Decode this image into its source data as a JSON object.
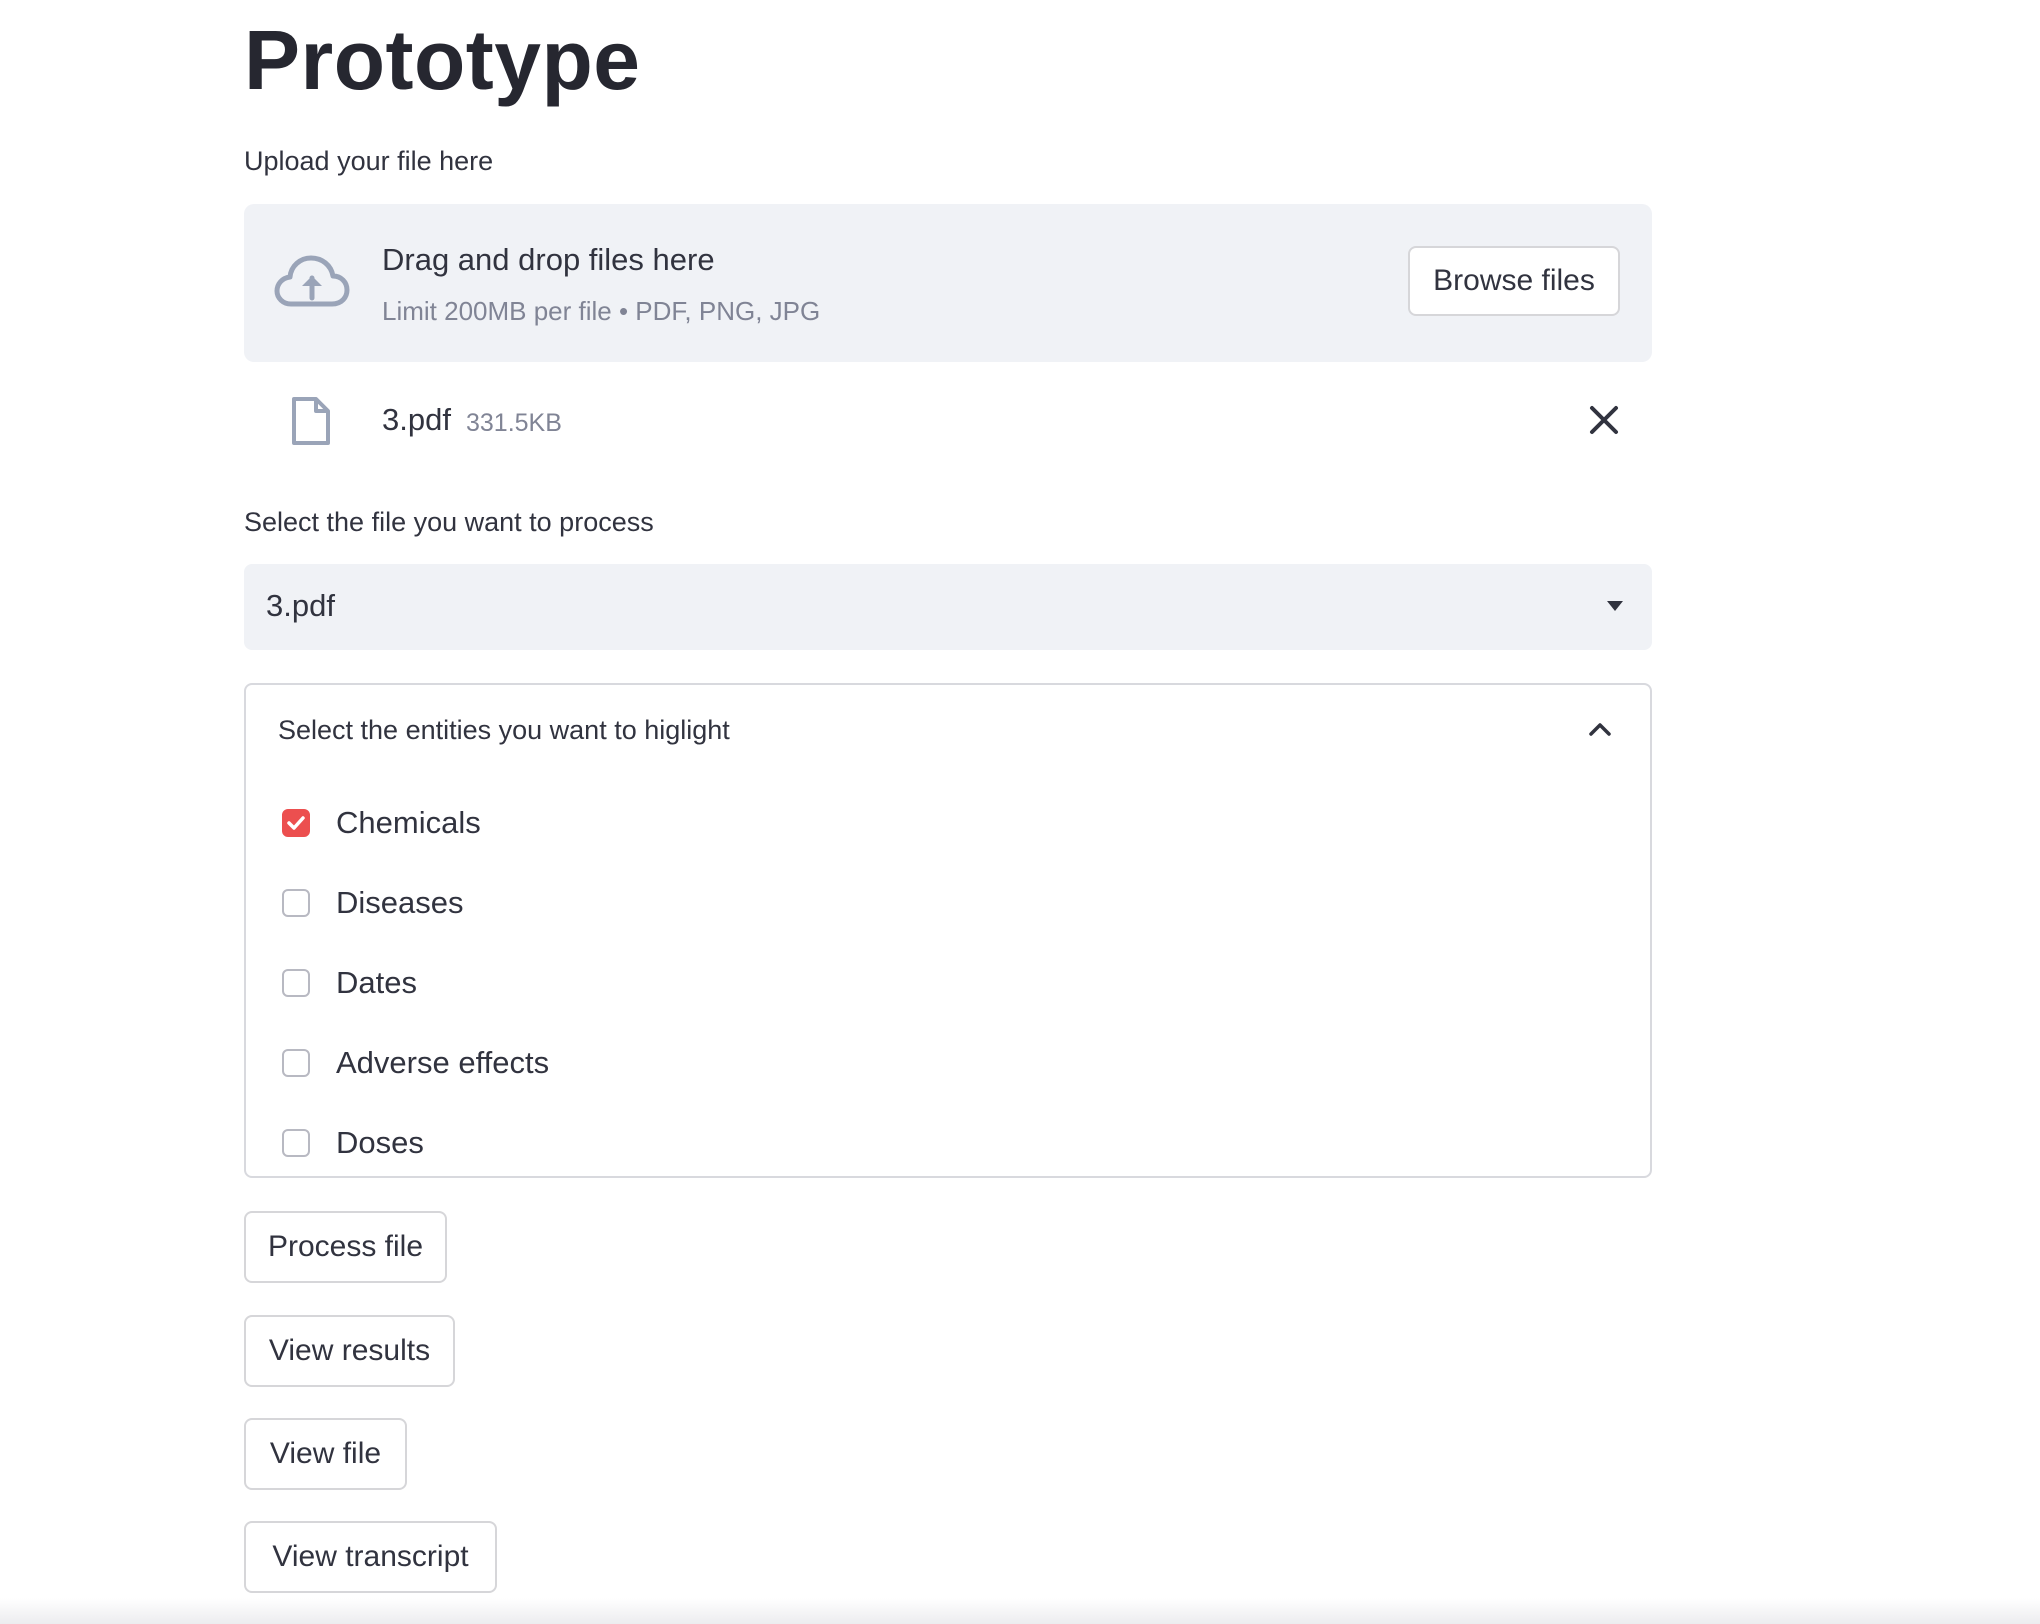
{
  "page": {
    "title": "Prototype"
  },
  "uploader": {
    "label": "Upload your file here",
    "drop_title": "Drag and drop files here",
    "drop_subtitle": "Limit 200MB per file • PDF, PNG, JPG",
    "browse_label": "Browse files",
    "icon": "cloud-upload-icon",
    "uploaded_file": {
      "name": "3.pdf",
      "size": "331.5KB",
      "icon": "file-icon"
    }
  },
  "file_select": {
    "label": "Select the file you want to process",
    "value": "3.pdf"
  },
  "entities": {
    "title": "Select the entities you want to higlight",
    "expanded": true,
    "options": [
      {
        "label": "Chemicals",
        "checked": true
      },
      {
        "label": "Diseases",
        "checked": false
      },
      {
        "label": "Dates",
        "checked": false
      },
      {
        "label": "Adverse effects",
        "checked": false
      },
      {
        "label": "Doses",
        "checked": false
      }
    ]
  },
  "actions": {
    "process_label": "Process file",
    "results_label": "View results",
    "view_file_label": "View file",
    "transcript_label": "View transcript"
  },
  "colors": {
    "accent": "#ec4f4f",
    "panel_bg": "#f0f2f6",
    "text": "#31333f",
    "muted": "#808495"
  }
}
